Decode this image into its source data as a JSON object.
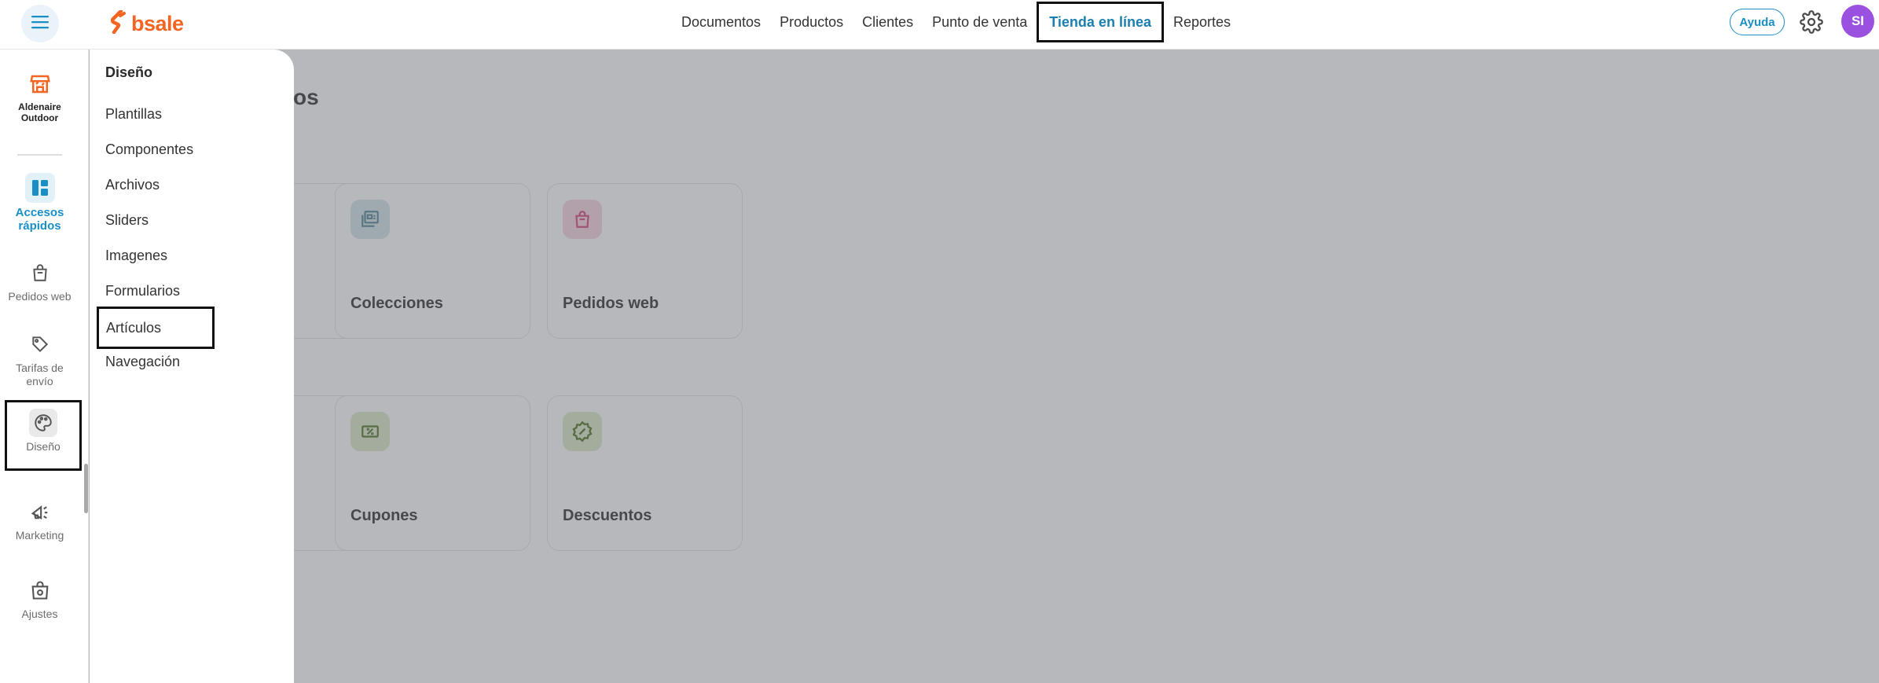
{
  "header": {
    "logo_text": "bsale",
    "nav": [
      {
        "label": "Documentos",
        "active": false
      },
      {
        "label": "Productos",
        "active": false
      },
      {
        "label": "Clientes",
        "active": false
      },
      {
        "label": "Punto de venta",
        "active": false
      },
      {
        "label": "Tienda en línea",
        "active": true
      },
      {
        "label": "Reportes",
        "active": false
      }
    ],
    "help_label": "Ayuda",
    "avatar_initials": "SI",
    "colors": {
      "brand": "#f26522",
      "accent": "#1a8fc6",
      "avatar": "#9b51e0"
    }
  },
  "sidebar": {
    "store_name_line1": "Aldenaire",
    "store_name_line2": "Outdoor",
    "items": [
      {
        "label_line1": "Accesos",
        "label_line2": "rápidos",
        "icon": "dashboard-icon",
        "active": true
      },
      {
        "label_line1": "Pedidos web",
        "label_line2": "",
        "icon": "shopping-bag-icon",
        "active": false
      },
      {
        "label_line1": "Tarifas de",
        "label_line2": "envío",
        "icon": "tag-icon",
        "active": false
      },
      {
        "label_line1": "Diseño",
        "label_line2": "",
        "icon": "palette-icon",
        "active": false
      },
      {
        "label_line1": "Marketing",
        "label_line2": "",
        "icon": "megaphone-icon",
        "active": false
      },
      {
        "label_line1": "Ajustes",
        "label_line2": "",
        "icon": "settings-bag-icon",
        "active": false
      }
    ]
  },
  "flyout": {
    "title": "Diseño",
    "items": [
      {
        "label": "Plantillas"
      },
      {
        "label": "Componentes"
      },
      {
        "label": "Archivos"
      },
      {
        "label": "Sliders"
      },
      {
        "label": "Imagenes"
      },
      {
        "label": "Formularios"
      },
      {
        "label": "Artículos"
      },
      {
        "label": "Navegación"
      }
    ]
  },
  "main": {
    "title_visible_fragment": "os",
    "cards": [
      {
        "label": "Colecciones",
        "icon": "collection-icon",
        "color": "#5b8fa0",
        "bg": "#cfe3ea"
      },
      {
        "label": "Pedidos web",
        "icon": "shopping-bag-icon",
        "color": "#d63c7a",
        "bg": "#f6d2e0"
      },
      {
        "label": "Cupones",
        "icon": "coupon-icon",
        "color": "#5a7f27",
        "bg": "#d9e8c6"
      },
      {
        "label": "Descuentos",
        "icon": "discount-badge-icon",
        "color": "#5a7f27",
        "bg": "#d9e8c6"
      }
    ]
  }
}
